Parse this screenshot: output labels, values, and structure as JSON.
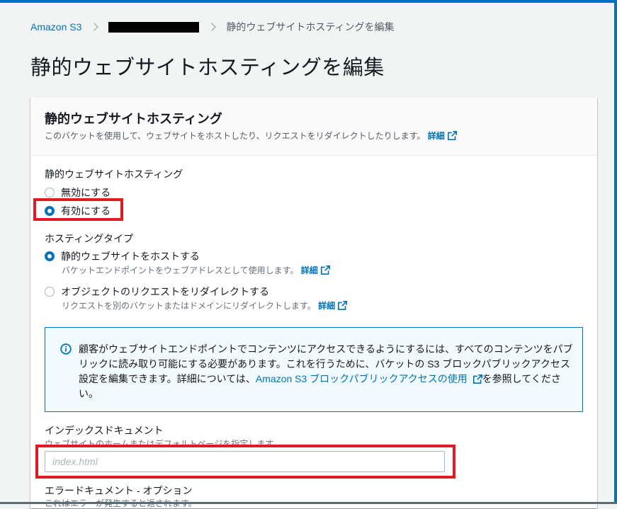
{
  "breadcrumb": {
    "root": "Amazon S3",
    "current": "静的ウェブサイトホスティングを編集"
  },
  "page_title": "静的ウェブサイトホスティングを編集",
  "panel": {
    "title": "静的ウェブサイトホスティング",
    "description": "このバケットを使用して、ウェブサイトをホストしたり、リクエストをリダイレクトしたりします。",
    "info_link": "詳細"
  },
  "hosting": {
    "label": "静的ウェブサイトホスティング",
    "options": [
      {
        "label": "無効にする",
        "checked": false
      },
      {
        "label": "有効にする",
        "checked": true
      }
    ]
  },
  "hosting_type": {
    "label": "ホスティングタイプ",
    "options": [
      {
        "label": "静的ウェブサイトをホストする",
        "description": "バケットエンドポイントをウェブアドレスとして使用します。",
        "link": "詳細",
        "checked": true
      },
      {
        "label": "オブジェクトのリクエストをリダイレクトする",
        "description": "リクエストを別のバケットまたはドメインにリダイレクトします。",
        "link": "詳細",
        "checked": false
      }
    ]
  },
  "alert": {
    "text_before": "顧客がウェブサイトエンドポイントでコンテンツにアクセスできるようにするには、すべてのコンテンツをパブリックに読み取り可能にする必要があります。これを行うために、バケットの S3 ブロックパブリックアクセス設定を編集できます。詳細については、",
    "link": "Amazon S3 ブロックパブリックアクセスの使用",
    "text_after": "を参照してください。"
  },
  "index_document": {
    "label": "インデックスドキュメント",
    "description": "ウェブサイトのホームまたはデフォルトページを指定します。",
    "placeholder": "index.html",
    "value": ""
  },
  "error_document": {
    "label": "エラードキュメント - オプション",
    "description": "これはエラーが発生すると返されます。"
  },
  "colors": {
    "accent": "#0073bb",
    "highlight": "#e21b22",
    "alert_bg": "#f1faff"
  },
  "icons": {
    "external": "external-link-icon",
    "info": "info-circle-icon",
    "separator": "chevron-right-icon"
  }
}
